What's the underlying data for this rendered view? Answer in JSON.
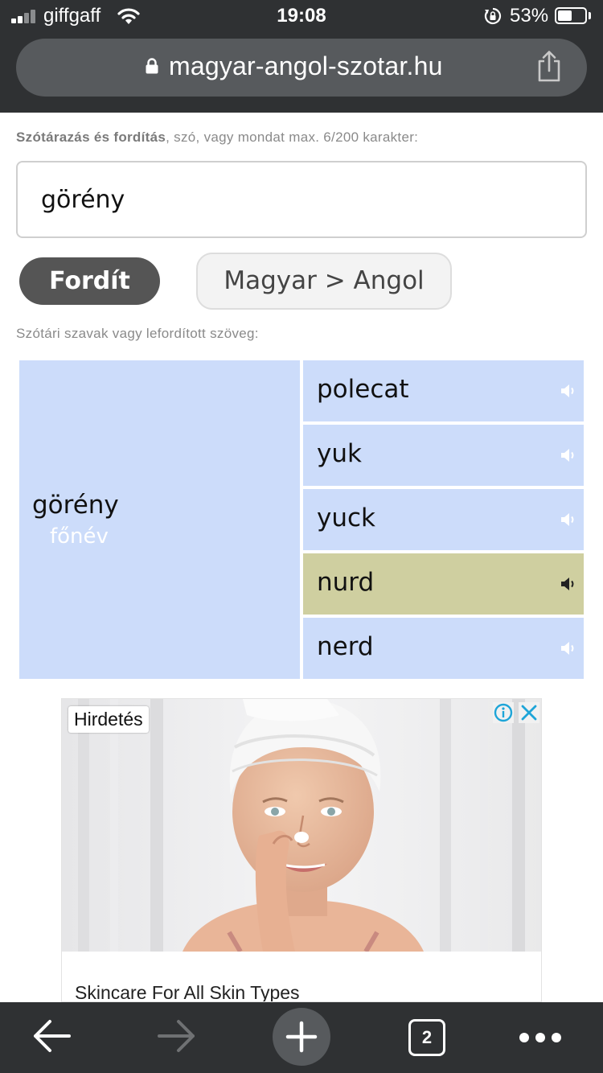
{
  "status_bar": {
    "carrier": "giffgaff",
    "time": "19:08",
    "battery_percent": "53%",
    "battery_level": 0.53,
    "signal_bars": 2
  },
  "browser": {
    "url": "magyar-angol-szotar.hu"
  },
  "page": {
    "hint_bold": "Szótárazás és fordítás",
    "hint_rest": ", szó, vagy mondat max. 6/200 karakter:",
    "search_value": "görény",
    "translate_button": "Fordít",
    "language_button": "Magyar > Angol",
    "results_label": "Szótári szavak vagy lefordított szöveg:"
  },
  "result": {
    "source_word": "görény",
    "part_of_speech": "főnév",
    "translations": [
      {
        "word": "polecat",
        "active": false
      },
      {
        "word": "yuk",
        "active": false
      },
      {
        "word": "yuck",
        "active": false
      },
      {
        "word": "nurd",
        "active": true
      },
      {
        "word": "nerd",
        "active": false
      }
    ]
  },
  "ad": {
    "badge": "Hirdetés",
    "title": "Skincare For All Skin Types"
  },
  "toolbar": {
    "tab_count": "2"
  },
  "colors": {
    "chrome": "#2f3133",
    "url_pill": "#575a5d",
    "result_bg": "#ccdcfa",
    "active_row_bg": "#cfcfa0",
    "ad_icons": "#1ea5d8"
  },
  "icons": [
    "signal-icon",
    "wifi-icon",
    "rotation-lock-icon",
    "battery-icon",
    "lock-icon",
    "share-icon",
    "speaker-icon",
    "info-icon",
    "close-icon",
    "back-arrow-icon",
    "forward-arrow-icon",
    "plus-icon",
    "tabs-icon",
    "more-icon"
  ]
}
